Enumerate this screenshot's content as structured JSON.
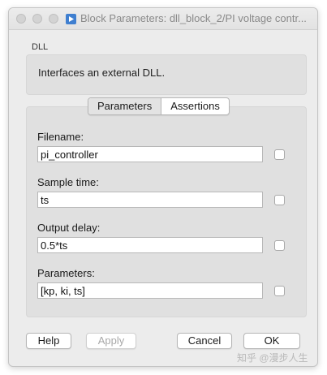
{
  "window": {
    "title": "Block Parameters: dll_block_2/PI voltage contr...",
    "app_icon": "simulink-block-icon"
  },
  "block": {
    "type_label": "DLL",
    "description": "Interfaces an external DLL."
  },
  "tabs": [
    {
      "label": "Parameters",
      "active": true
    },
    {
      "label": "Assertions",
      "active": false
    }
  ],
  "fields": [
    {
      "label": "Filename:",
      "value": "pi_controller",
      "checked": false
    },
    {
      "label": "Sample time:",
      "value": "ts",
      "checked": false
    },
    {
      "label": "Output delay:",
      "value": "0.5*ts",
      "checked": false
    },
    {
      "label": "Parameters:",
      "value": "[kp, ki, ts]",
      "checked": false
    }
  ],
  "buttons": {
    "help": "Help",
    "apply": "Apply",
    "cancel": "Cancel",
    "ok": "OK"
  },
  "watermark": "知乎 @漫步人生"
}
